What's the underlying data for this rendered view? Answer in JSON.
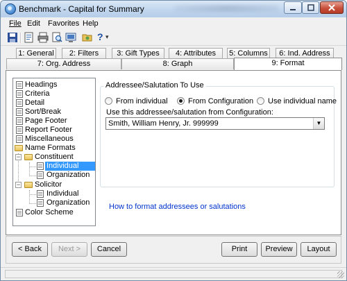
{
  "window": {
    "title": "Benchmark - Capital for Summary"
  },
  "menu": [
    {
      "key": "F",
      "rest": "ile"
    },
    {
      "key": "E",
      "rest": "dit"
    },
    {
      "key": "",
      "rest": "Favorites",
      "key_mid": "a"
    },
    {
      "key": "H",
      "rest": "elp"
    }
  ],
  "menu_labels": {
    "file": "File",
    "edit": "Edit",
    "favorites": "Favorites",
    "help": "Help"
  },
  "toolbar": {
    "help_glyph": "?",
    "dropdown_glyph": "▾"
  },
  "tabs_row1": [
    "1: General",
    "2: Filters",
    "3: Gift Types",
    "4: Attributes",
    "5: Columns",
    "6: Ind. Address"
  ],
  "tabs_row2": [
    "7: Org. Address",
    "8: Graph",
    "9: Format"
  ],
  "active_tab": "9: Format",
  "tree": {
    "items": [
      {
        "label": "Headings"
      },
      {
        "label": "Criteria"
      },
      {
        "label": "Detail"
      },
      {
        "label": "Sort/Break"
      },
      {
        "label": "Page Footer"
      },
      {
        "label": "Report Footer"
      },
      {
        "label": "Miscellaneous"
      },
      {
        "label": "Name Formats"
      },
      {
        "label": "Constituent"
      },
      {
        "label": "Individual"
      },
      {
        "label": "Organization"
      },
      {
        "label": "Solicitor"
      },
      {
        "label": "Individual"
      },
      {
        "label": "Organization"
      },
      {
        "label": "Color Scheme"
      }
    ],
    "selected": "Individual"
  },
  "groupbox": {
    "title": "Addressee/Salutation To Use",
    "radios": [
      {
        "label": "From individual",
        "checked": false
      },
      {
        "label": "From Configuration",
        "checked": true
      },
      {
        "label": "Use individual name",
        "checked": false
      }
    ],
    "combo_label": "Use this addressee/salutation from Configuration:",
    "combo_value": "Smith, William Henry, Jr. 999999"
  },
  "help_link": "How to format addressees or salutations",
  "buttons": {
    "back": "< Back",
    "next": "Next >",
    "cancel": "Cancel",
    "print": "Print",
    "preview": "Preview",
    "layout": "Layout"
  },
  "colors": {
    "selection": "#3399ff",
    "link": "#0033cc",
    "title_bar": "#c1d6ee"
  }
}
